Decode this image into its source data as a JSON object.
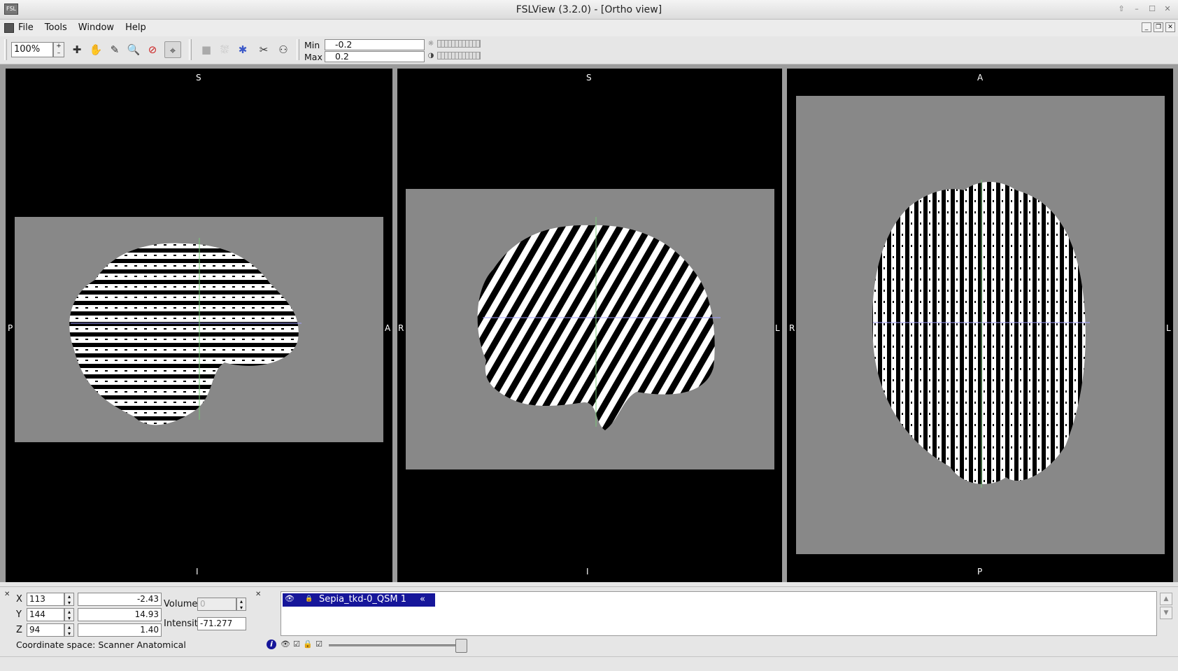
{
  "window": {
    "title": "FSLView (3.2.0) - [Ortho view]"
  },
  "menu": {
    "file": "File",
    "tools": "Tools",
    "window": "Window",
    "help": "Help"
  },
  "toolbar": {
    "zoom": "100%",
    "min_label": "Min",
    "min_value": "-0.2",
    "max_label": "Max",
    "max_value": "0.2",
    "tools": [
      "cursor-cross-icon",
      "hand-pan-icon",
      "pencil-icon",
      "zoom-icon",
      "unzoom-icon",
      "crosshair-target-icon",
      "mask-icon",
      "fill-icon",
      "star-icon",
      "scissors-icon",
      "binoculars-icon"
    ]
  },
  "views": {
    "sagittal": {
      "top": "S",
      "bottom": "I",
      "left": "P",
      "right": "A"
    },
    "coronal": {
      "top": "S",
      "bottom": "I",
      "left": "R",
      "right": "L"
    },
    "axial": {
      "top": "A",
      "bottom": "P",
      "left": "R",
      "right": "L"
    }
  },
  "cursor": {
    "x_label": "X",
    "x_voxel": "113",
    "x_mm": "-2.43",
    "y_label": "Y",
    "y_voxel": "144",
    "y_mm": "14.93",
    "z_label": "Z",
    "z_voxel": "94",
    "z_mm": "1.40",
    "volume_label": "Volume",
    "volume_value": "0",
    "intensity_label": "Intensity",
    "intensity_value": "-71.277",
    "coord_space": "Coordinate space: Scanner Anatomical"
  },
  "layers": [
    {
      "name": "Sepia_tkd-0_QSM 1"
    }
  ],
  "layer_opacity": 1.0,
  "colors": {
    "background": "#000000",
    "slice_bg": "#888888",
    "layer_highlight": "#16169a",
    "crosshair_h": "#a0a0ff",
    "crosshair_v": "#78c878"
  }
}
